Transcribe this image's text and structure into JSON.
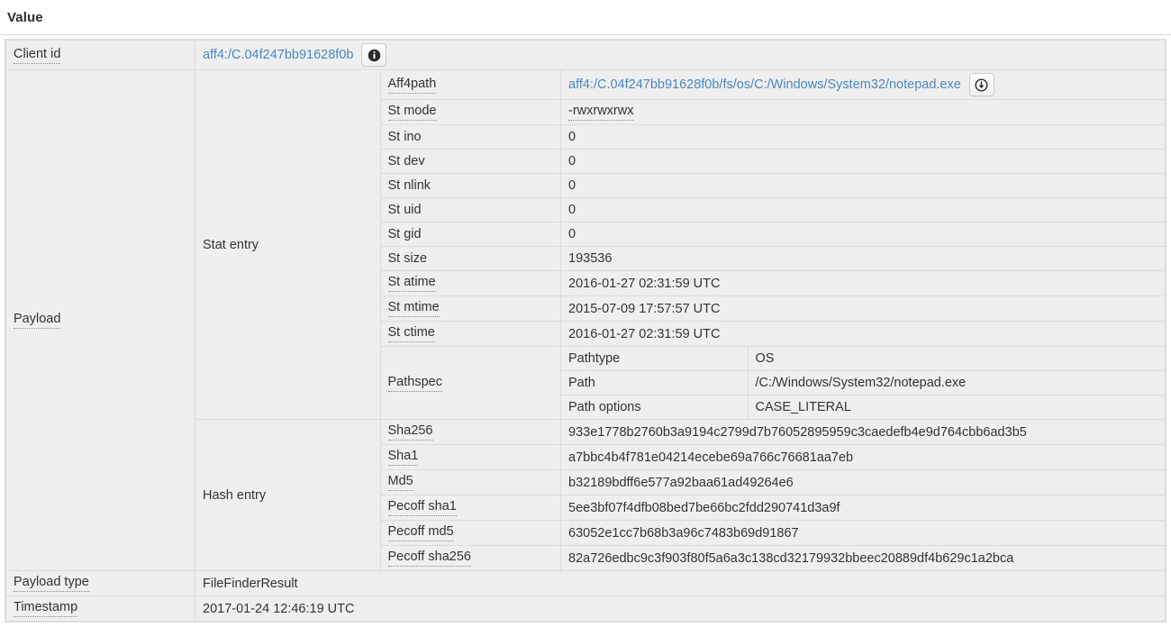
{
  "header": {
    "title": "Value"
  },
  "rows": {
    "client_id": {
      "label": "Client id",
      "value": "aff4:/C.04f247bb91628f0b",
      "info_button": "info-icon"
    },
    "payload": {
      "label": "Payload"
    },
    "payload_type": {
      "label": "Payload type",
      "value": "FileFinderResult"
    },
    "timestamp": {
      "label": "Timestamp",
      "value": "2017-01-24 12:46:19 UTC"
    }
  },
  "stat_entry": {
    "label": "Stat entry",
    "aff4path": {
      "label": "Aff4path",
      "value": "aff4:/C.04f247bb91628f0b/fs/os/C:/Windows/System32/notepad.exe",
      "download_button": "download-icon"
    },
    "fields": [
      {
        "label": "St mode",
        "value": "-rwxrwxrwx",
        "dotted": true
      },
      {
        "label": "St ino",
        "value": "0",
        "dotted": false
      },
      {
        "label": "St dev",
        "value": "0",
        "dotted": false
      },
      {
        "label": "St nlink",
        "value": "0",
        "dotted": false
      },
      {
        "label": "St uid",
        "value": "0",
        "dotted": false
      },
      {
        "label": "St gid",
        "value": "0",
        "dotted": false
      },
      {
        "label": "St size",
        "value": "193536",
        "dotted": false
      },
      {
        "label": "St atime",
        "value": "2016-01-27 02:31:59 UTC",
        "dotted": true
      },
      {
        "label": "St mtime",
        "value": "2015-07-09 17:57:57 UTC",
        "dotted": true
      },
      {
        "label": "St ctime",
        "value": "2016-01-27 02:31:59 UTC",
        "dotted": true
      }
    ],
    "pathspec": {
      "label": "Pathspec",
      "fields": [
        {
          "label": "Pathtype",
          "value": "OS"
        },
        {
          "label": "Path",
          "value": "/C:/Windows/System32/notepad.exe"
        },
        {
          "label": "Path options",
          "value": "CASE_LITERAL"
        }
      ]
    }
  },
  "hash_entry": {
    "label": "Hash entry",
    "fields": [
      {
        "label": "Sha256",
        "value": "933e1778b2760b3a9194c2799d7b76052895959c3caedefb4e9d764cbb6ad3b5"
      },
      {
        "label": "Sha1",
        "value": "a7bbc4b4f781e04214ecebe69a766c76681aa7eb"
      },
      {
        "label": "Md5",
        "value": "b32189bdff6e577a92baa61ad49264e6"
      },
      {
        "label": "Pecoff sha1",
        "value": "5ee3bf07f4dfb08bed7be66bc2fdd290741d3a9f"
      },
      {
        "label": "Pecoff md5",
        "value": "63052e1cc7b68b3a96c7483b69d91867"
      },
      {
        "label": "Pecoff sha256",
        "value": "82a726edbc9c3f903f80f5a6a3c138cd32179932bbeec20889df4b629c1a2bca"
      }
    ]
  },
  "colors": {
    "link": "#4b86c2",
    "cell_bg": "#efefef",
    "border": "#dcdcdc",
    "text": "#333333"
  }
}
